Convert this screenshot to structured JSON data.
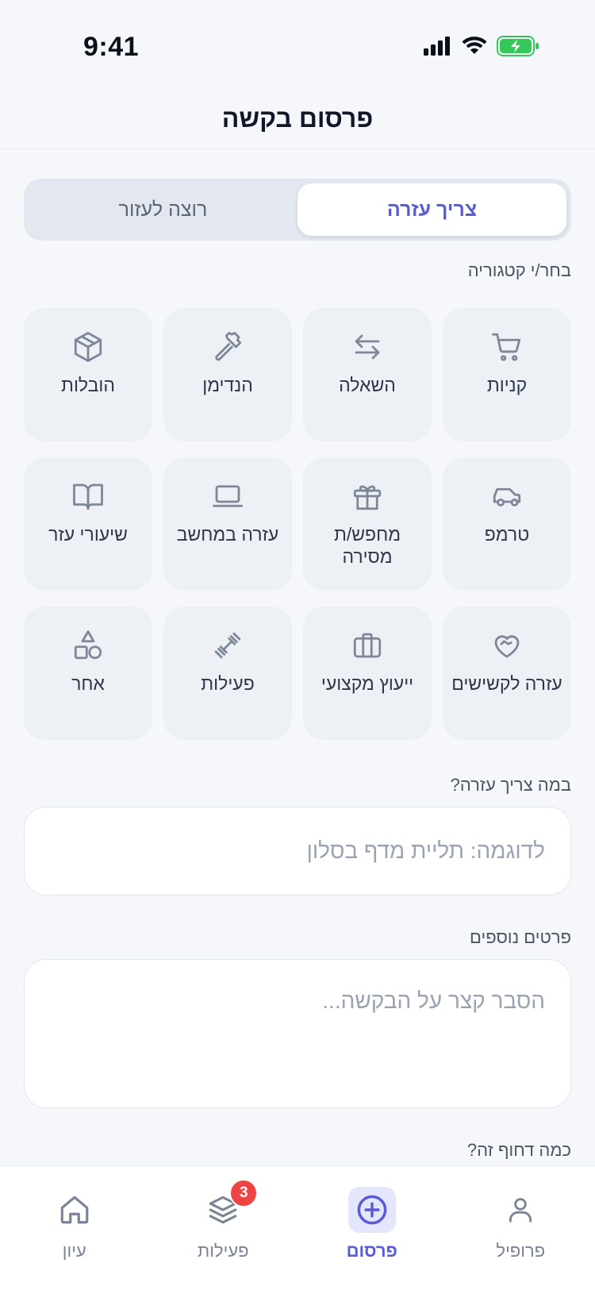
{
  "status_bar": {
    "time": "9:41"
  },
  "header": {
    "title": "פרסום בקשה"
  },
  "mode_toggle": {
    "options": [
      "צריך עזרה",
      "רוצה לעזור"
    ],
    "selected": "צריך עזרה"
  },
  "category_section": {
    "label": "בחר/י קטגוריה",
    "items": [
      {
        "label": "קניות",
        "icon": "shopping-cart-icon"
      },
      {
        "label": "השאלה",
        "icon": "swap-arrows-icon"
      },
      {
        "label": "הנדימן",
        "icon": "hammer-icon"
      },
      {
        "label": "הובלות",
        "icon": "package-box-icon"
      },
      {
        "label": "טרמפ",
        "icon": "car-icon"
      },
      {
        "label": "מחפש/ת מסירה",
        "icon": "gift-icon"
      },
      {
        "label": "עזרה במחשב",
        "icon": "laptop-icon"
      },
      {
        "label": "שיעורי עזר",
        "icon": "open-book-icon"
      },
      {
        "label": "עזרה לקשישים",
        "icon": "heart-handshake-icon"
      },
      {
        "label": "ייעוץ מקצועי",
        "icon": "briefcase-icon"
      },
      {
        "label": "פעילות",
        "icon": "dumbbell-icon"
      },
      {
        "label": "אחר",
        "icon": "shapes-icon"
      }
    ]
  },
  "what_field": {
    "label": "במה צריך עזרה?",
    "placeholder": "לדוגמה: תליית מדף בסלון",
    "value": ""
  },
  "details_field": {
    "label": "פרטים נוספים",
    "placeholder": "הסבר קצר על הבקשה...",
    "value": ""
  },
  "urgency_section": {
    "label": "כמה דחוף זה?"
  },
  "tab_bar": {
    "tabs": [
      {
        "label": "פרופיל",
        "icon": "user-icon",
        "active": false
      },
      {
        "label": "פרסום",
        "icon": "plus-circle-icon",
        "active": true
      },
      {
        "label": "פעילות",
        "icon": "layers-icon",
        "active": false,
        "badge": "3"
      },
      {
        "label": "עיון",
        "icon": "home-icon",
        "active": false
      }
    ]
  },
  "colors": {
    "accent": "#5B5BD6",
    "badge": "#EF4444",
    "background": "#F5F7FB",
    "card": "#EDF1F6"
  }
}
